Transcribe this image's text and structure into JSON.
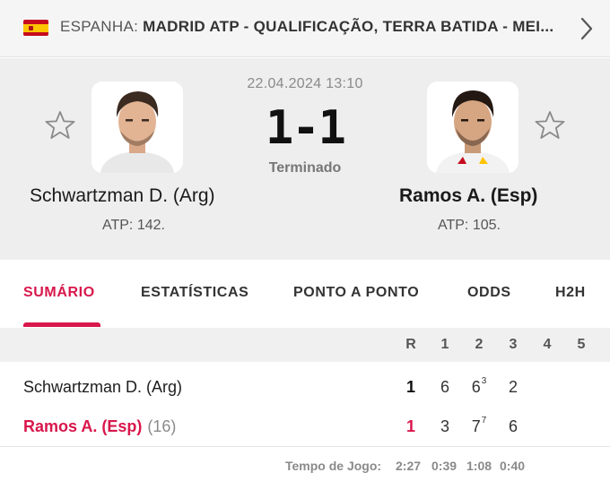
{
  "breadcrumb": {
    "country": "ESPANHA:",
    "league": "MADRID ATP - QUALIFICAÇÃO, TERRA BATIDA - MEI..."
  },
  "match": {
    "datetime": "22.04.2024 13:10",
    "score": "1-1",
    "status": "Terminado"
  },
  "home": {
    "name": "Schwartzman D. (Arg)",
    "rank": "ATP: 142."
  },
  "away": {
    "name": "Ramos A. (Esp)",
    "rank": "ATP: 105."
  },
  "tabs": [
    {
      "label": "SUMÁRIO",
      "active": true
    },
    {
      "label": "ESTATÍSTICAS"
    },
    {
      "label": "PONTO A PONTO"
    },
    {
      "label": "ODDS"
    },
    {
      "label": "H2H"
    }
  ],
  "table": {
    "headers": [
      "R",
      "1",
      "2",
      "3",
      "4",
      "5"
    ],
    "rows": [
      {
        "name": "Schwartzman D. (Arg)",
        "seed": "",
        "r": "1",
        "s1": "6",
        "s2": "6",
        "s2_tb": "3",
        "s3": "2"
      },
      {
        "name": "Ramos A. (Esp)",
        "seed": "(16)",
        "r": "1",
        "s1": "3",
        "s2": "7",
        "s2_tb": "7",
        "s3": "6"
      }
    ]
  },
  "footer": {
    "label": "Tempo de Jogo:",
    "total": "2:27",
    "set_times": [
      "0:39",
      "1:08",
      "0:40"
    ]
  },
  "colors": {
    "accent": "#d8174b",
    "header_bg": "#eeeeee"
  },
  "icons": {
    "flag": "spain-flag-icon",
    "next": "chevron-right-icon",
    "favorite": "star-outline-icon"
  }
}
